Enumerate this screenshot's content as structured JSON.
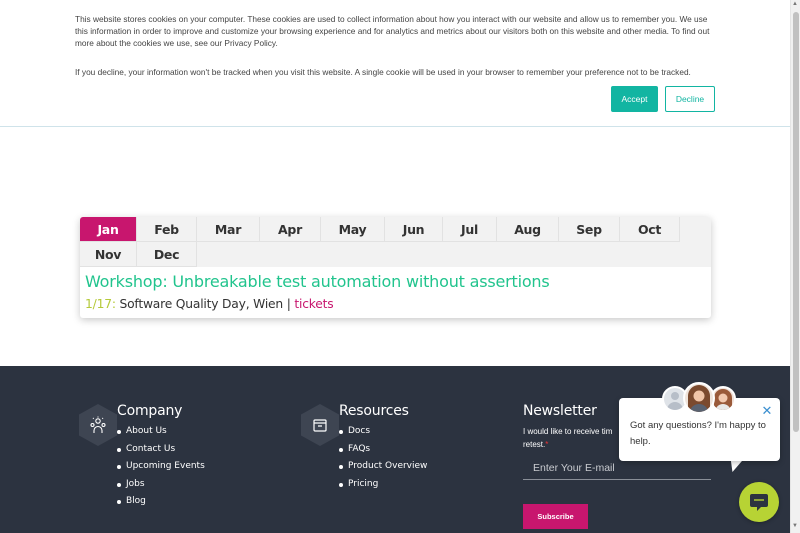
{
  "cookie_banner": {
    "text1": "This website stores cookies on your computer. These cookies are used to collect information about how you interact with our website and allow us to remember you. We use this information in order to improve and customize your browsing experience and for analytics and metrics about our visitors both on this website and other media. To find out more about the cookies we use, see our Privacy Policy.",
    "text2": "If you decline, your information won't be tracked when you visit this website. A single cookie will be used in your browser to remember your preference not to be tracked.",
    "accept_label": "Accept",
    "decline_label": "Decline"
  },
  "calendar": {
    "months": [
      "Jan",
      "Feb",
      "Mar",
      "Apr",
      "May",
      "Jun",
      "Jul",
      "Aug",
      "Sep",
      "Oct",
      "Nov",
      "Dec"
    ],
    "active_month": "Jan",
    "event_title": "Workshop: Unbreakable test automation without assertions",
    "event_date": "1/17:",
    "event_text": " Software Quality Day, Wien | ",
    "event_link": "tickets"
  },
  "footer": {
    "company": {
      "title": "Company",
      "icon": "team-icon",
      "items": [
        "About Us",
        "Contact Us",
        "Upcoming Events",
        "Jobs",
        "Blog"
      ]
    },
    "resources": {
      "title": "Resources",
      "icon": "box-icon",
      "items": [
        "Docs",
        "FAQs",
        "Product Overview",
        "Pricing"
      ]
    },
    "newsletter": {
      "title": "Newsletter",
      "text_visible": "I would like to receive tim",
      "text_visible2": "retest.",
      "required_mark": "*",
      "placeholder": "Enter Your E-mail",
      "subscribe_label": "Subscribe"
    }
  },
  "chat": {
    "message": "Got any questions? I'm happy to help.",
    "close_icon": "close-icon",
    "launcher_icon": "chat-icon"
  },
  "colors": {
    "accent_teal": "#12b5a2",
    "brand_magenta": "#c8166e",
    "event_green": "#21c48d",
    "date_lime": "#b5c93a",
    "footer_bg": "#2c3340",
    "chat_green": "#b7d334"
  }
}
